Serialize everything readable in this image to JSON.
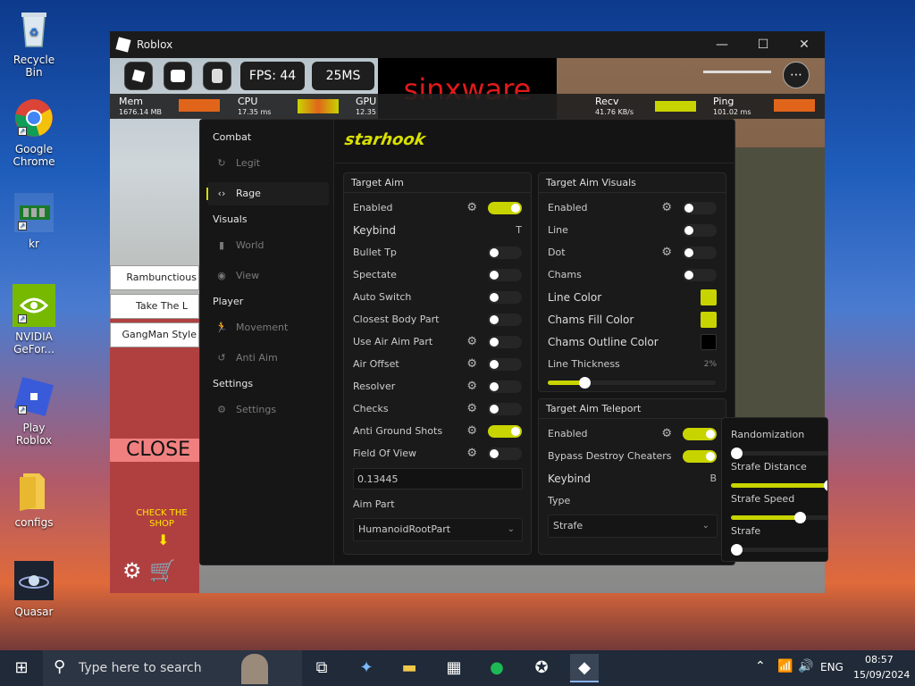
{
  "desktop": {
    "icons": [
      {
        "label": "Recycle Bin"
      },
      {
        "label": "Google Chrome"
      },
      {
        "label": "kr"
      },
      {
        "label": "NVIDIA GeFor..."
      },
      {
        "label": "Play Roblox"
      },
      {
        "label": "configs"
      },
      {
        "label": "Quasar"
      }
    ]
  },
  "window": {
    "title": "Roblox",
    "minimize": "—",
    "maximize": "☐",
    "close": "✕"
  },
  "topbar": {
    "fps": "FPS: 44",
    "ms": "25MS",
    "sinxware": "sinxware",
    "more": "⋯"
  },
  "stats": {
    "mem_label": "Mem",
    "mem_value": "1676.14 MB",
    "cpu_label": "CPU",
    "cpu_value": "17.35 ms",
    "gpu_label": "GPU",
    "gpu_value": "12.35",
    "recv_label": "Recv",
    "recv_value": "41.76 KB/s",
    "ping_label": "Ping",
    "ping_value": "101.02 ms"
  },
  "game": {
    "list": [
      "Rambunctious",
      "Take The L",
      "GangMan Style"
    ],
    "close_label": "CLOSE",
    "check_shop": "CHECK THE SHOP"
  },
  "panel": {
    "logo": "starhook",
    "categories": {
      "combat": "Combat",
      "visuals": "Visuals",
      "player": "Player",
      "settings": "Settings"
    },
    "items": {
      "legit": "Legit",
      "rage": "Rage",
      "world": "World",
      "view": "View",
      "movement": "Movement",
      "antiaim": "Anti Aim",
      "settings": "Settings"
    },
    "target_aim": {
      "title": "Target Aim",
      "enabled": "Enabled",
      "keybind": "Keybind",
      "keybind_value": "T",
      "bullet_tp": "Bullet Tp",
      "spectate": "Spectate",
      "auto_switch": "Auto Switch",
      "closest_body_part": "Closest Body Part",
      "use_air_aim_part": "Use Air Aim Part",
      "air_offset": "Air Offset",
      "resolver": "Resolver",
      "checks": "Checks",
      "anti_ground_shots": "Anti Ground Shots",
      "field_of_view": "Field Of View",
      "fov_value": "0.13445",
      "aim_part": "Aim Part",
      "aim_part_value": "HumanoidRootPart"
    },
    "visuals": {
      "title": "Target Aim Visuals",
      "enabled": "Enabled",
      "line": "Line",
      "dot": "Dot",
      "chams": "Chams",
      "line_color": "Line Color",
      "chams_fill_color": "Chams Fill Color",
      "chams_outline_color": "Chams Outline Color",
      "line_thickness": "Line Thickness",
      "line_thickness_value": "2%",
      "line_thickness_fraction": 0.22,
      "accent": "#c8d400",
      "outline_color": "#000000"
    },
    "teleport": {
      "title": "Target Aim Teleport",
      "enabled": "Enabled",
      "bypass": "Bypass Destroy Cheaters",
      "keybind": "Keybind",
      "keybind_value": "B",
      "type": "Type",
      "type_value": "Strafe"
    },
    "popout": {
      "randomization": "Randomization",
      "randomization_fraction": 0.0,
      "strafe_distance": "Strafe Distance",
      "strafe_distance_fraction": 1.0,
      "strafe_speed": "Strafe Speed",
      "strafe_speed_fraction": 0.55,
      "strafe": "Strafe",
      "strafe_fraction": 0.0
    }
  },
  "taskbar": {
    "search_placeholder": "Type here to search",
    "lang": "ENG",
    "time": "08:57",
    "date": "15/09/2024"
  }
}
